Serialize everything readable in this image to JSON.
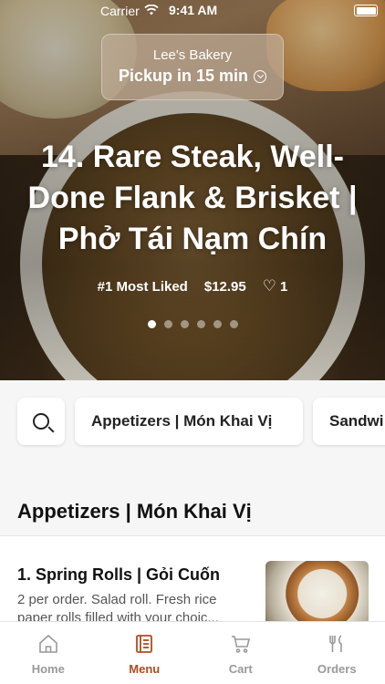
{
  "status_bar": {
    "carrier": "Carrier",
    "time": "9:41 AM"
  },
  "pickup": {
    "store_name": "Lee's Bakery",
    "pickup_text": "Pickup in 15 min"
  },
  "hero": {
    "title": "14. Rare Steak, Well-Done Flank & Brisket | Phở Tái Nạm Chín",
    "badge": "#1 Most Liked",
    "price": "$12.95",
    "likes": "1",
    "carousel_dots": 6,
    "active_dot": 0
  },
  "categories": {
    "items": [
      "Appetizers | Món Khai Vị",
      "Sandwi"
    ]
  },
  "section": {
    "title": "Appetizers | Món Khai Vị"
  },
  "menu_item": {
    "name": "1. Spring Rolls | Gỏi Cuốn",
    "description": "2 per order. Salad roll. Fresh rice paper rolls filled with your choic..."
  },
  "tabbar": {
    "tabs": [
      {
        "label": "Home",
        "icon": "home-icon"
      },
      {
        "label": "Menu",
        "icon": "menu-icon"
      },
      {
        "label": "Cart",
        "icon": "cart-icon"
      },
      {
        "label": "Orders",
        "icon": "orders-icon"
      }
    ],
    "active_index": 1,
    "accent": "#b04b1e"
  }
}
